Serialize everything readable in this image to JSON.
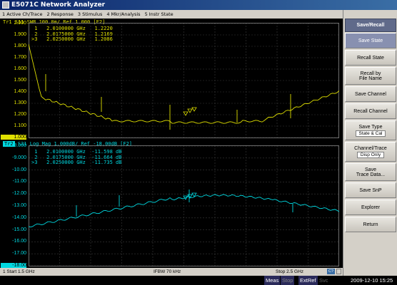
{
  "window": {
    "title": "E5071C Network Analyzer"
  },
  "menu": [
    "1 Active Ch/Trace",
    "2 Response",
    "3 Stimulus",
    "4 Mkr/Analysis",
    "5 Instr State"
  ],
  "trace1": {
    "header": "Tr1  S11  SWR 100.0m/ Ref 1.000 [F2]",
    "markers": [
      " 1   2.0100000 GHz   1.2220",
      " 2   2.0175000 GHz   1.2169",
      ">3   2.0250000 GHz   1.2086"
    ],
    "yticks": [
      "2.000",
      "1.900",
      "1.800",
      "1.700",
      "1.600",
      "1.500",
      "1.400",
      "1.300",
      "1.200",
      "1.100",
      "1.000"
    ],
    "color": "#e0e000"
  },
  "trace2": {
    "badge": "Tr2",
    "header": " S21  Log Mag 1.000dB/ Ref -18.00dB [F2]",
    "markers": [
      " 1   2.0100000 GHz  -11.598 dB",
      " 2   2.0175000 GHz  -11.664 dB",
      ">3   2.0250000 GHz  -11.735 dB"
    ],
    "yticks": [
      "-8.000",
      "-9.000",
      "-10.00",
      "-11.00",
      "-12.00",
      "-13.00",
      "-14.00",
      "-15.00",
      "-16.00",
      "-17.00",
      "-18.00"
    ],
    "color": "#00d8e0"
  },
  "status": {
    "start": "1  Start 1.5 GHz",
    "ifbw": "IFBW 70 kHz",
    "stop": "Stop 2.5 GHz",
    "ch": "C?"
  },
  "bottom": {
    "meas": "Meas",
    "stop": "Stop",
    "extref": "ExtRef",
    "svc": "Svc",
    "datetime": "2009-12-10 15:25"
  },
  "softkeys": {
    "title": "Save/Recall",
    "save_state": "Save State",
    "recall_state": "Recall State",
    "recall_by_file_1": "Recall by",
    "recall_by_file_2": "File Name",
    "save_channel": "Save Channel",
    "recall_channel": "Recall Channel",
    "save_type": "Save Type",
    "save_type_value": "State & Cal",
    "channel_trace": "Channel/Trace",
    "channel_trace_value": "Disp Only",
    "save_trace_1": "Save",
    "save_trace_2": "Trace Data...",
    "save_snp": "Save SnP",
    "explorer": "Explorer",
    "return": "Return"
  }
}
